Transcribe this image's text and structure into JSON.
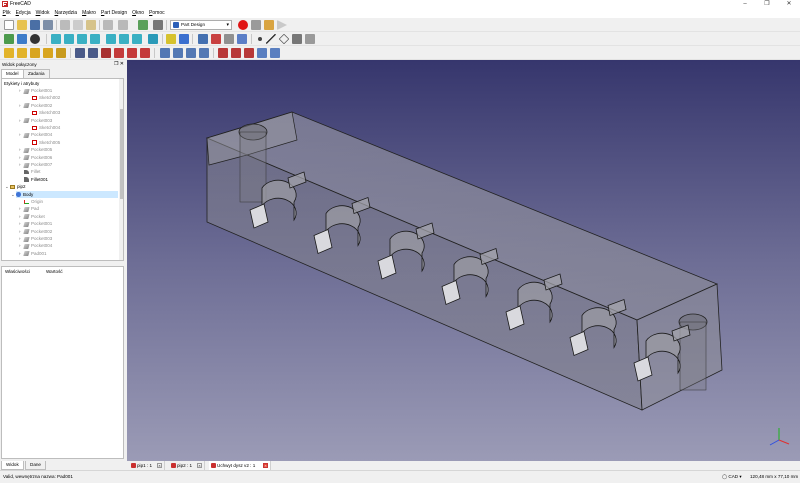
{
  "window": {
    "title": "FreeCAD"
  },
  "menu": [
    "Plik",
    "Edycja",
    "Widok",
    "Narzędzia",
    "Makro",
    "Part Design",
    "Okno",
    "Pomoc"
  ],
  "workbench": {
    "selected": "Part Design"
  },
  "combo": {
    "title": "Widok połączony",
    "tabs": [
      "Model",
      "Zadania"
    ],
    "bottom_tabs": [
      "Widok",
      "Dane"
    ]
  },
  "tree": {
    "section": "Etykiety i atrybuty",
    "rows": [
      {
        "label": "Pocket001",
        "icon": "pocket-icon",
        "grey": true
      },
      {
        "label": "Sketch002",
        "icon": "sketch-icon",
        "grey": true
      },
      {
        "label": "Pocket002",
        "icon": "pocket-icon",
        "grey": true
      },
      {
        "label": "Sketch003",
        "icon": "sketch-icon",
        "grey": true
      },
      {
        "label": "Pocket003",
        "icon": "pocket-icon",
        "grey": true
      },
      {
        "label": "Sketch004",
        "icon": "sketch-icon",
        "grey": true
      },
      {
        "label": "Pocket004",
        "icon": "pocket-icon",
        "grey": true
      },
      {
        "label": "Sketch005",
        "icon": "sketch-icon",
        "grey": true
      },
      {
        "label": "Pocket005",
        "icon": "pocket-icon",
        "grey": true
      },
      {
        "label": "Pocket006",
        "icon": "pocket-icon",
        "grey": true
      },
      {
        "label": "Pocket007",
        "icon": "pocket-icon",
        "grey": true
      },
      {
        "label": "Fillet",
        "icon": "fillet-icon",
        "grey": true
      },
      {
        "label": "Fillet001",
        "icon": "fillet-icon",
        "grey": false
      },
      {
        "label": "pip2",
        "icon": "part-icon",
        "grey": false
      },
      {
        "label": "Body",
        "icon": "body-icon",
        "grey": false,
        "selected": true
      },
      {
        "label": "Origin",
        "icon": "origin-icon",
        "grey": true
      },
      {
        "label": "Pad",
        "icon": "pad-icon",
        "grey": true
      },
      {
        "label": "Pocket",
        "icon": "pocket-icon",
        "grey": true
      },
      {
        "label": "Pocket001",
        "icon": "pocket-icon",
        "grey": true
      },
      {
        "label": "Pocket002",
        "icon": "pocket-icon",
        "grey": true
      },
      {
        "label": "Pocket003",
        "icon": "pocket-icon",
        "grey": true
      },
      {
        "label": "Pocket004",
        "icon": "pocket-icon",
        "grey": true
      },
      {
        "label": "Pad001",
        "icon": "pad-icon",
        "grey": true
      }
    ]
  },
  "properties": {
    "col_property": "Właściwości",
    "col_value": "Wartość"
  },
  "doc_tabs": [
    {
      "label": "pip1 : 1",
      "active": false
    },
    {
      "label": "pip2 : 1",
      "active": false
    },
    {
      "label": "Uchwyt dysz v2 : 1",
      "active": true
    }
  ],
  "status": {
    "message": "Valid, wewnętrzna nazwa: Pad001",
    "navigation": "CAD",
    "dimensions": "120,48 mm x 77,10 mm"
  },
  "colors": {
    "viewport_top": "#36366d",
    "viewport_bottom": "#9b9bb6",
    "selection": "#cce8ff"
  }
}
